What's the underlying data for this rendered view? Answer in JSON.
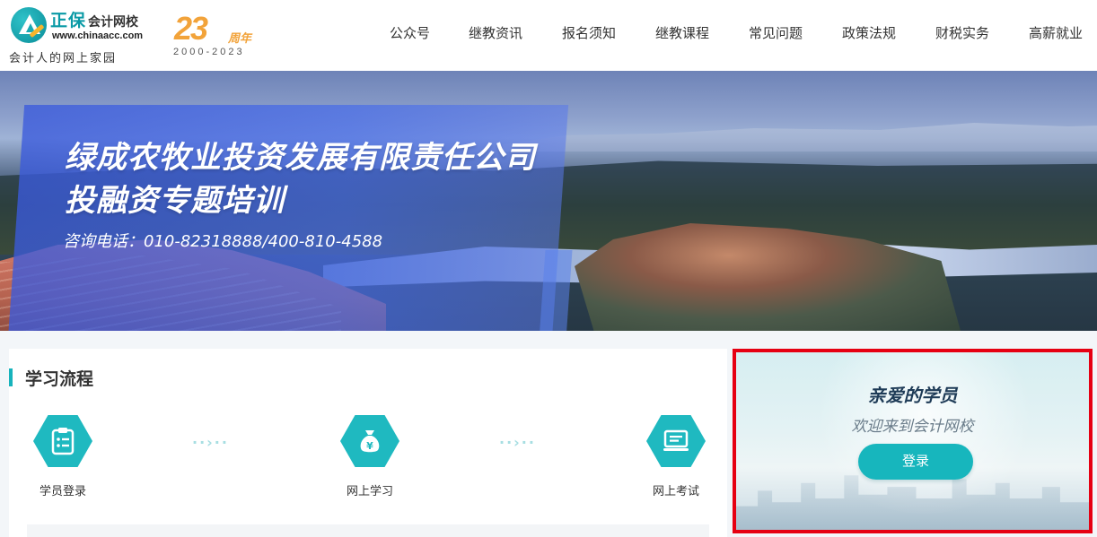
{
  "header": {
    "logo": {
      "brand": "正保",
      "brand_suffix": "会计网校",
      "url": "www.chinaacc.com",
      "slogan": "会计人的网上家园",
      "icon": "chinaacc-logo-icon"
    },
    "anniversary": {
      "number": "23",
      "suffix": "周年",
      "years": "2000-2023"
    },
    "nav": [
      {
        "label": "公众号"
      },
      {
        "label": "继教资讯"
      },
      {
        "label": "报名须知"
      },
      {
        "label": "继教课程"
      },
      {
        "label": "常见问题"
      },
      {
        "label": "政策法规"
      },
      {
        "label": "财税实务"
      },
      {
        "label": "高薪就业"
      }
    ]
  },
  "banner": {
    "title_line1": "绿成农牧业投资发展有限责任公司",
    "title_line2": "投融资专题培训",
    "phone": "咨询电话：010-82318888/400-810-4588"
  },
  "process": {
    "title": "学习流程",
    "steps": [
      {
        "label": "学员登录",
        "icon": "clipboard-icon"
      },
      {
        "label": "网上学习",
        "icon": "money-bag-icon"
      },
      {
        "label": "网上考试",
        "icon": "computer-icon"
      }
    ],
    "separator": "··›··"
  },
  "login": {
    "greeting": "亲爱的学员",
    "welcome": "欢迎来到会计网校",
    "button": "登录"
  },
  "colors": {
    "accent": "#17b6bd",
    "highlight_border": "#e60012",
    "anniversary": "#f2a33a"
  }
}
